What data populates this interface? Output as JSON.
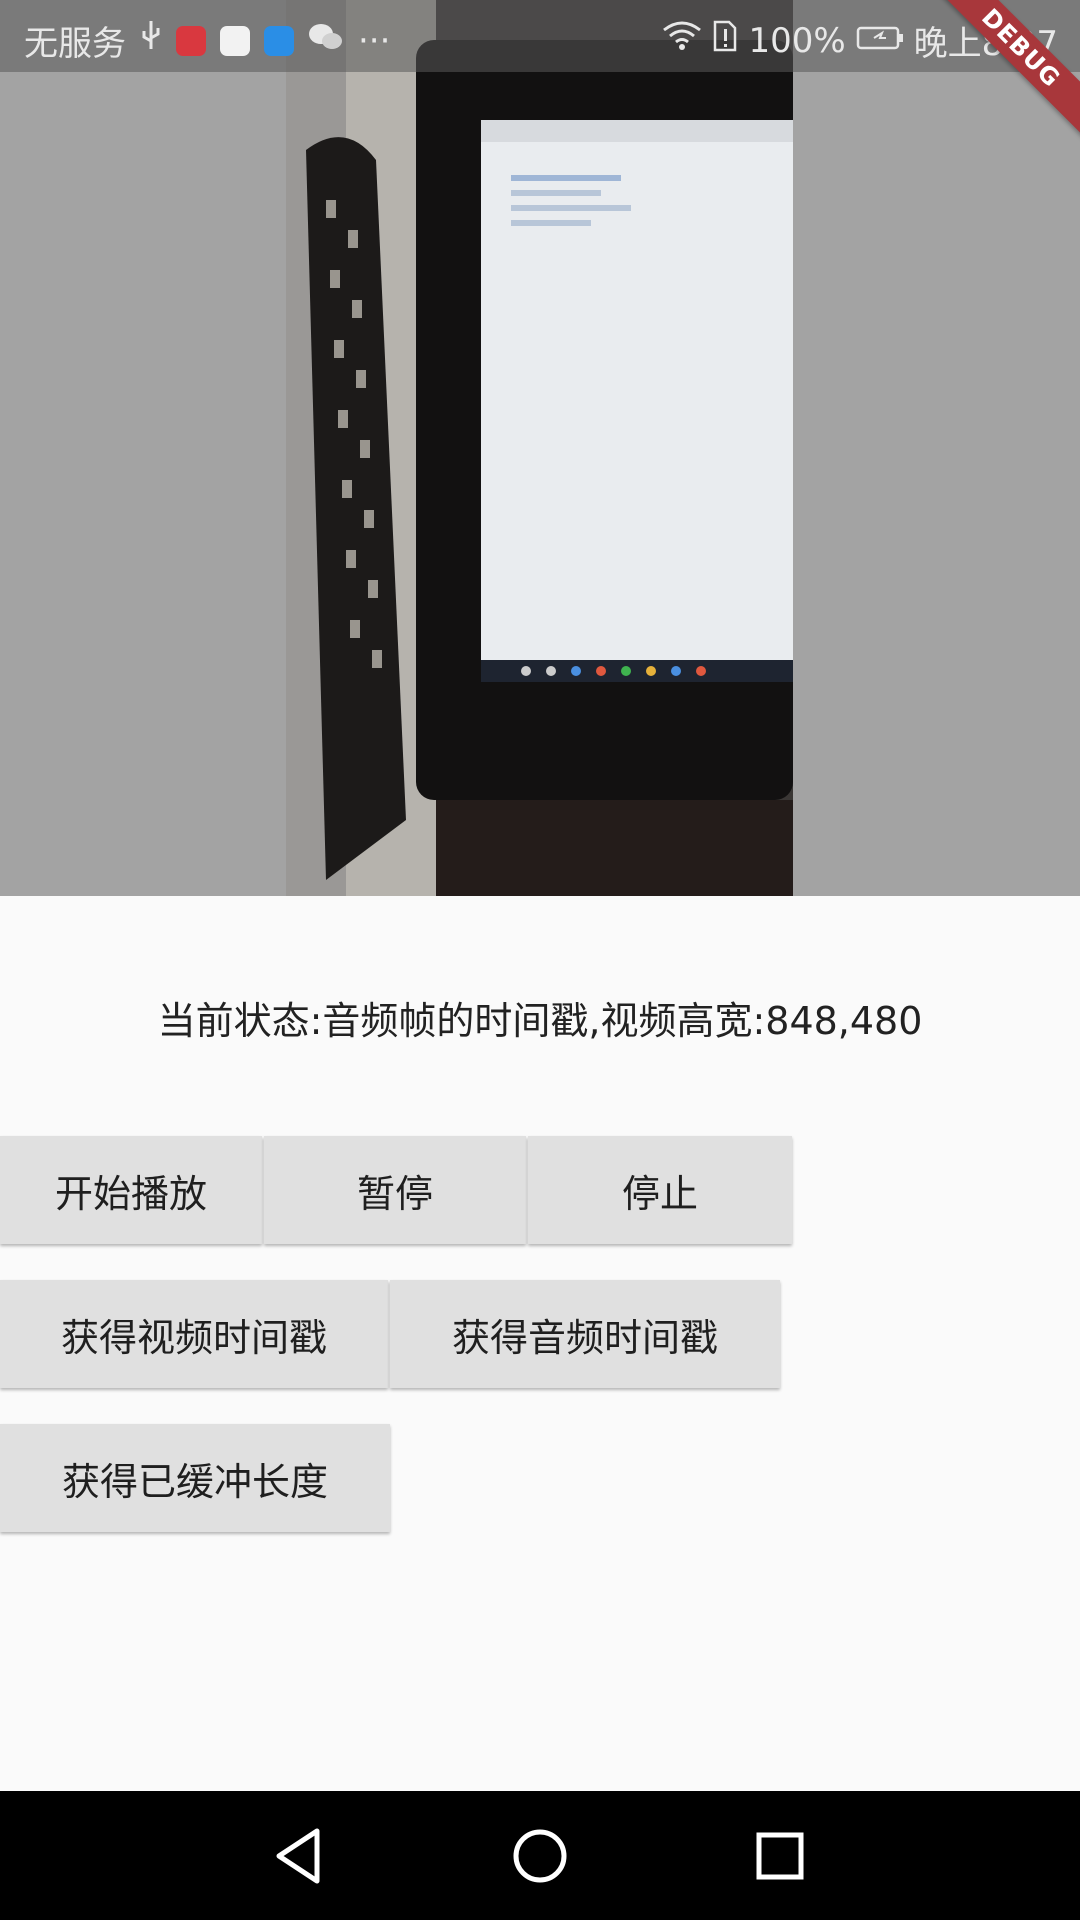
{
  "status_bar": {
    "carrier": "无服务",
    "battery": "100%",
    "time": "晚上8:07",
    "more": "···"
  },
  "debug_banner": "DEBUG",
  "status_line": "当前状态:音频帧的时间戳,视频高宽:848,480",
  "buttons": {
    "start": "开始播放",
    "pause": "暂停",
    "stop": "停止",
    "video_ts": "获得视频时间戳",
    "audio_ts": "获得音频时间戳",
    "buffered": "获得已缓冲长度"
  },
  "icons": {
    "usb": "usb-icon",
    "huawei": "huawei-app-icon",
    "gallery": "gallery-app-icon",
    "video": "video-app-icon",
    "wechat": "wechat-icon",
    "wifi": "wifi-icon",
    "sim": "sim-alert-icon",
    "battery": "battery-charging-icon",
    "back": "back-icon",
    "home": "home-icon",
    "recents": "recents-icon"
  },
  "colors": {
    "video_bg": "#a3a3a3",
    "button_bg": "#e0e0e0",
    "page_bg": "#fafafa",
    "debug_banner": "#a8373b",
    "nav_bar": "#000000"
  }
}
